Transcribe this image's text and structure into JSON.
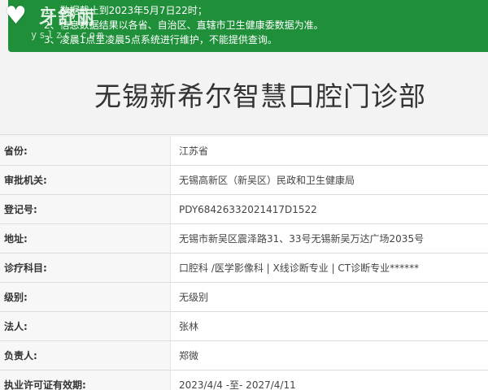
{
  "notice": {
    "lines": [
      "1、数据截止到2023年5月7日22时；",
      "2、信息数据结果以各省、自治区、直辖市卫生健康委数据为准。",
      "3、凌晨1点至凌晨5点系统进行维护，不能提供查询。"
    ],
    "background_color": "#1f8f3a"
  },
  "logo": {
    "brand": "牙舒丽",
    "domain": "yslzc.com"
  },
  "title": "无锡新希尔智慧口腔门诊部",
  "rows": [
    {
      "label": "省份:",
      "value": "江苏省"
    },
    {
      "label": "审批机关:",
      "value": "无锡高新区（新吴区）民政和卫生健康局"
    },
    {
      "label": "登记号:",
      "value": "PDY68426332021417D1522"
    },
    {
      "label": "地址:",
      "value": "无锡市新吴区震泽路31、33号无锡新吴万达广场2035号"
    },
    {
      "label": "诊疗科目:",
      "value": "口腔科 /医学影像科 | X线诊断专业 | CT诊断专业******"
    },
    {
      "label": "级别:",
      "value": "无级别"
    },
    {
      "label": "法人:",
      "value": "张林"
    },
    {
      "label": "负责人:",
      "value": "郑微"
    },
    {
      "label": "执业许可证有效期:",
      "value": "2023/4/4 -至- 2027/4/11"
    }
  ]
}
